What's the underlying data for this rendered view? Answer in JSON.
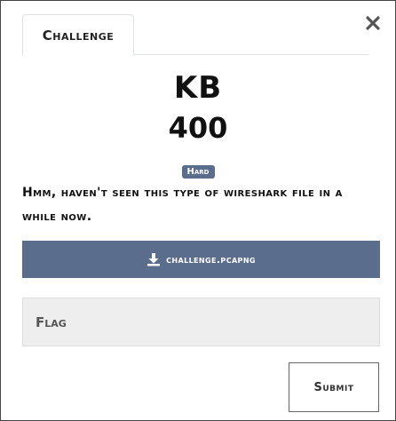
{
  "tabs": [
    {
      "label": "Challenge"
    }
  ],
  "challenge": {
    "name": "KB",
    "value": "400",
    "difficulty": "Hard",
    "description": "Hmm, haven't seen this type of wireshark file in a while now."
  },
  "download": {
    "filename": "challenge.pcapng",
    "icon": "download-icon"
  },
  "flag_input": {
    "placeholder": "Flag",
    "value": ""
  },
  "submit": {
    "label": "Submit"
  },
  "icons": {
    "close": "close-icon"
  },
  "colors": {
    "accent": "#5a6d8c",
    "input_bg": "#eeeeee",
    "border": "#444444"
  }
}
